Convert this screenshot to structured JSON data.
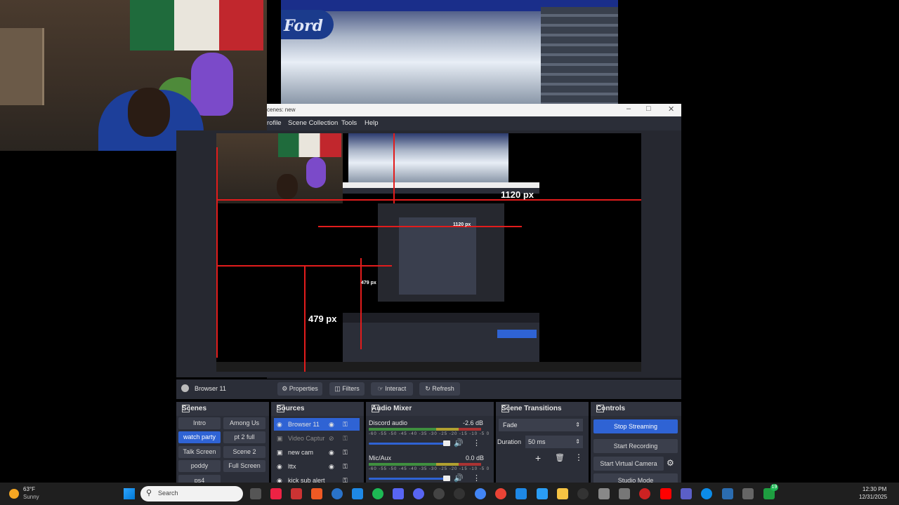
{
  "obs": {
    "window_title": "cenes: new",
    "menu": [
      "rofile",
      "Scene Collection",
      "Tools",
      "Help"
    ],
    "preview_labels": {
      "width_label": "1120 px",
      "height_label": "479 px",
      "inner_width_label": "1120 px",
      "inner_height_label": "479 px"
    },
    "source_toolbar": {
      "source_name": "Browser 11",
      "properties": "Properties",
      "filters": "Filters",
      "interact": "Interact",
      "refresh": "Refresh"
    },
    "scenes": {
      "title": "Scenes",
      "items": [
        "Intro",
        "Among Us",
        "watch party",
        "pt 2 full",
        "Talk Screen",
        "Scene 2",
        "poddy",
        "Full Screen",
        "ps4"
      ],
      "active": "watch party"
    },
    "sources": {
      "title": "Sources",
      "items": [
        "Browser 11",
        "Video Captur",
        "new cam",
        "lttx",
        "kick sub alert"
      ],
      "active": "Browser 11"
    },
    "audio_mixer": {
      "title": "Audio Mixer",
      "channels": [
        {
          "name": "Discord audio",
          "db": "-2.6 dB",
          "level": 0.85
        },
        {
          "name": "Mic/Aux",
          "db": "0.0 dB",
          "level": 1.0
        }
      ],
      "scale": [
        "-60",
        "-55",
        "-50",
        "-45",
        "-40",
        "-35",
        "-30",
        "-25",
        "-20",
        "-15",
        "-10",
        "-5",
        "0"
      ]
    },
    "scene_transitions": {
      "title": "Scene Transitions",
      "transition": "Fade",
      "duration_label": "Duration",
      "duration_value": "50 ms"
    },
    "controls": {
      "title": "Controls",
      "stop_streaming": "Stop Streaming",
      "start_recording": "Start Recording",
      "start_virtual_camera": "Start Virtual Camera",
      "studio_mode": "Studio Mode"
    }
  },
  "stadium": {
    "logo_text": "Ford"
  },
  "taskbar": {
    "weather_temp": "63°F",
    "weather_desc": "Sunny",
    "search_placeholder": "Search",
    "time": "12:30 PM",
    "date": "12/31/2025",
    "notification_badge": "19"
  }
}
